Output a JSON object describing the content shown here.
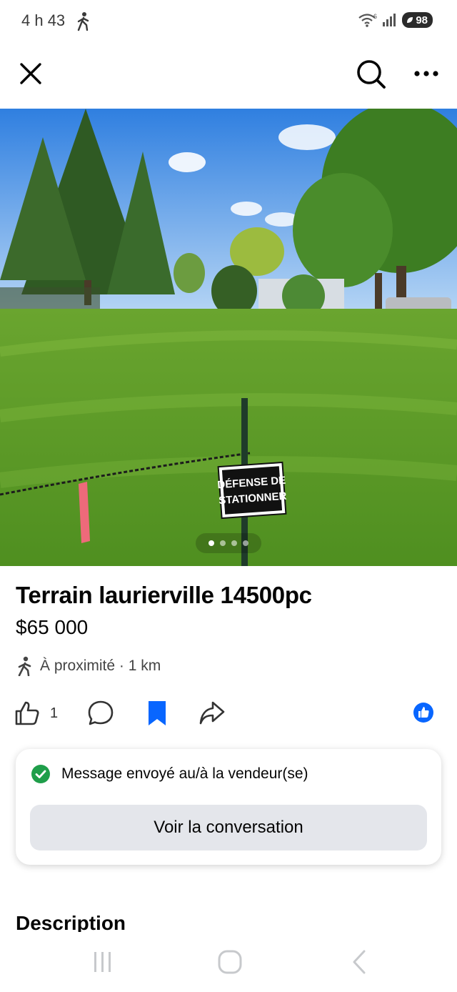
{
  "status_bar": {
    "time": "4 h 43",
    "battery": "98",
    "wifi_badge": "6"
  },
  "top_bar": {
    "close_icon": "close-icon",
    "search_icon": "search-icon",
    "more_icon": "more-horizontal-icon"
  },
  "photo": {
    "sign_line1": "DÉFENSE DE",
    "sign_line2": "STATIONNER",
    "page_count": 4,
    "active_page": 1
  },
  "listing": {
    "title": "Terrain laurierville 14500pc",
    "price": "$65 000",
    "location": "À proximité · 1 km"
  },
  "actions": {
    "like_count": "1",
    "accent_color": "#0866ff"
  },
  "message_card": {
    "status_text": "Message envoyé au/à la vendeur(se)",
    "button_label": "Voir la conversation",
    "check_color": "#1f9e4a"
  },
  "description": {
    "heading": "Description"
  }
}
